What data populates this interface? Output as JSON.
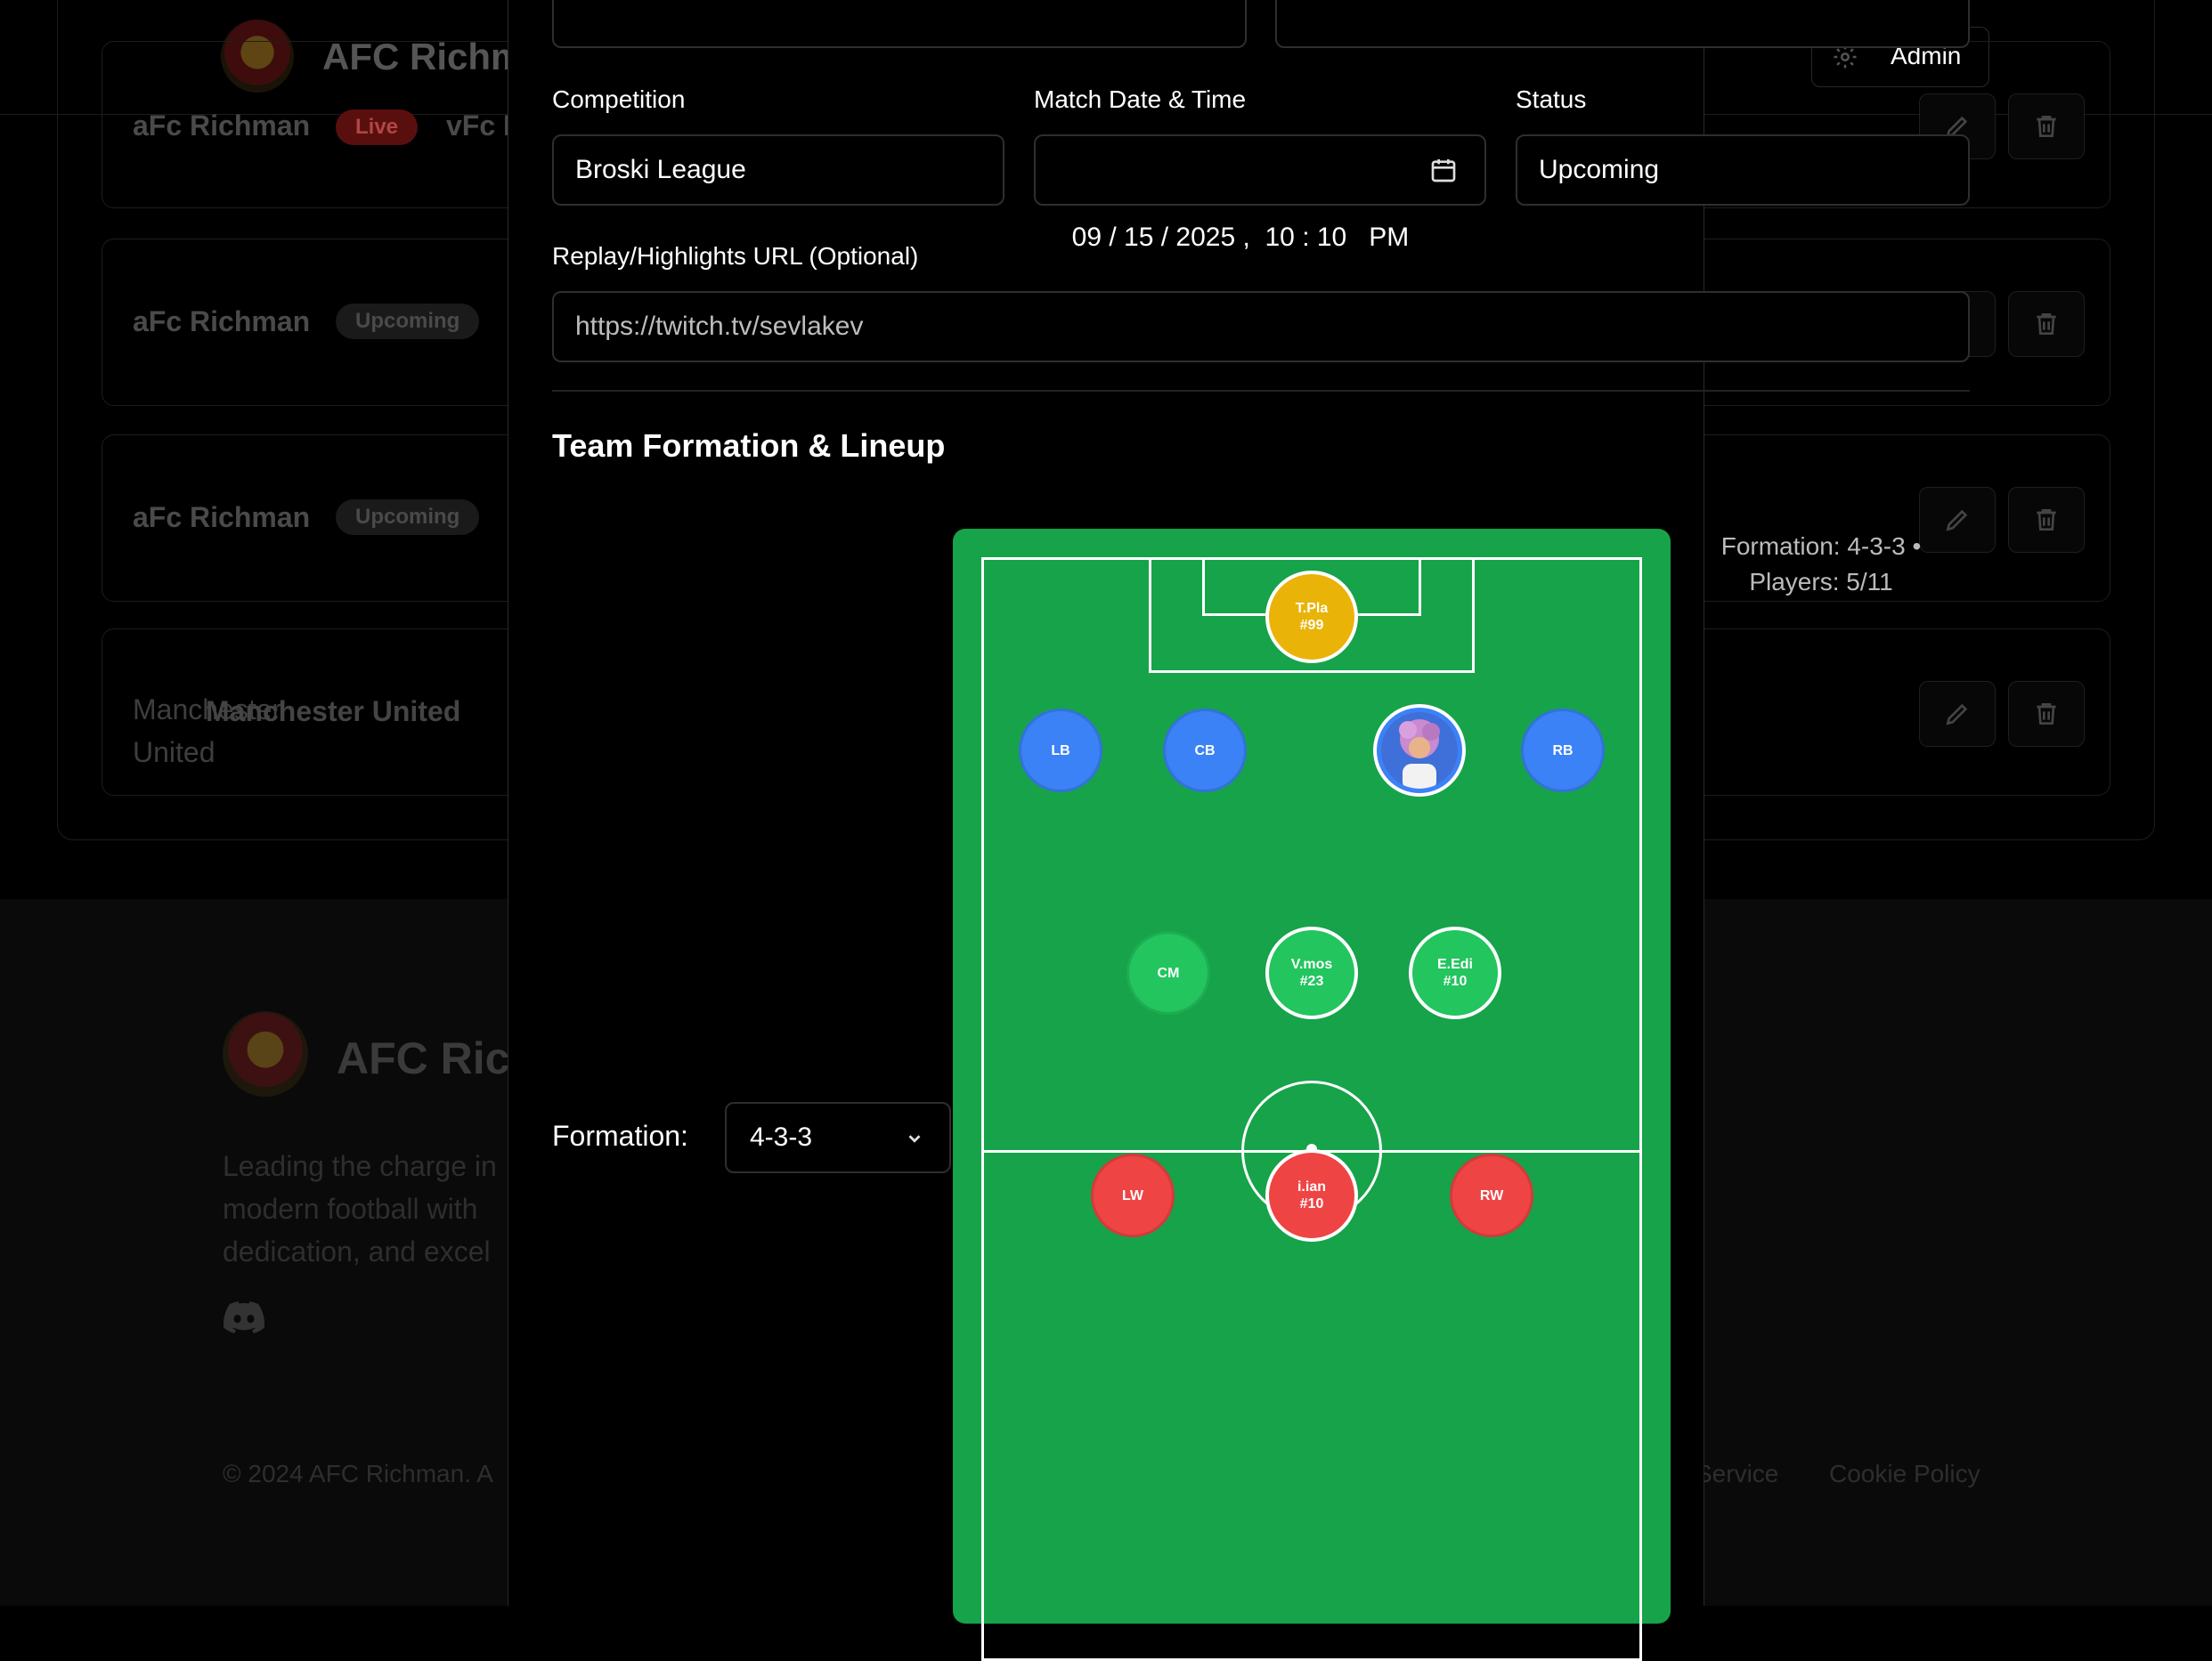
{
  "background": {
    "brand": "AFC Richman",
    "admin_label": "Admin",
    "matches": [
      {
        "team": "aFc Richman",
        "status": "Live",
        "opponent": "vFc I"
      },
      {
        "team": "aFc Richman",
        "status": "Upcoming"
      },
      {
        "team": "aFc Richman",
        "status": "Upcoming"
      },
      {
        "team": "Manchester\nUnited",
        "team_overlay": "Manchester United"
      }
    ],
    "footer": {
      "brand": "AFC Rich",
      "description": "Leading the charge in\nmodern football with\ndedication, and excel",
      "copyright": "© 2024 AFC Richman. A",
      "links": [
        "Service",
        "Cookie Policy"
      ]
    }
  },
  "modal": {
    "fields": {
      "competition": {
        "label": "Competition",
        "value": "Broski League"
      },
      "match_datetime": {
        "label": "Match Date & Time",
        "value": "09 / 15 / 2025 ,  10 : 10   PM"
      },
      "status": {
        "label": "Status",
        "value": "Upcoming"
      },
      "replay_url": {
        "label": "Replay/Highlights URL (Optional)",
        "value": "https://twitch.tv/sevlakev"
      }
    },
    "lineup": {
      "title": "Team Formation & Lineup",
      "formation_label": "Formation:",
      "formation_value": "4-3-3",
      "summary_line1": "Formation: 4-3-3 •",
      "summary_line2": "Players: 5/11",
      "players": [
        {
          "pos": "GK",
          "label": "T.Pla\n#99",
          "color": "#eab308",
          "assigned": true
        },
        {
          "pos": "LB",
          "label": "LB",
          "color": "#3b82f6",
          "assigned": false
        },
        {
          "pos": "CB1",
          "label": "CB",
          "color": "#3b82f6",
          "assigned": false
        },
        {
          "pos": "CB2",
          "label": "",
          "color": "#3b82f6",
          "assigned": true,
          "avatar": true
        },
        {
          "pos": "RB",
          "label": "RB",
          "color": "#3b82f6",
          "assigned": false
        },
        {
          "pos": "CM1",
          "label": "CM",
          "color": "#22c55e",
          "assigned": false
        },
        {
          "pos": "CM2",
          "label": "V.mos\n#23",
          "color": "#22c55e",
          "assigned": true
        },
        {
          "pos": "CM3",
          "label": "E.Edi\n#10",
          "color": "#22c55e",
          "assigned": true
        },
        {
          "pos": "LW",
          "label": "LW",
          "color": "#ef4444",
          "assigned": false
        },
        {
          "pos": "ST",
          "label": "i.ian\n#10",
          "color": "#ef4444",
          "assigned": true
        },
        {
          "pos": "RW",
          "label": "RW",
          "color": "#ef4444",
          "assigned": false
        }
      ]
    }
  }
}
